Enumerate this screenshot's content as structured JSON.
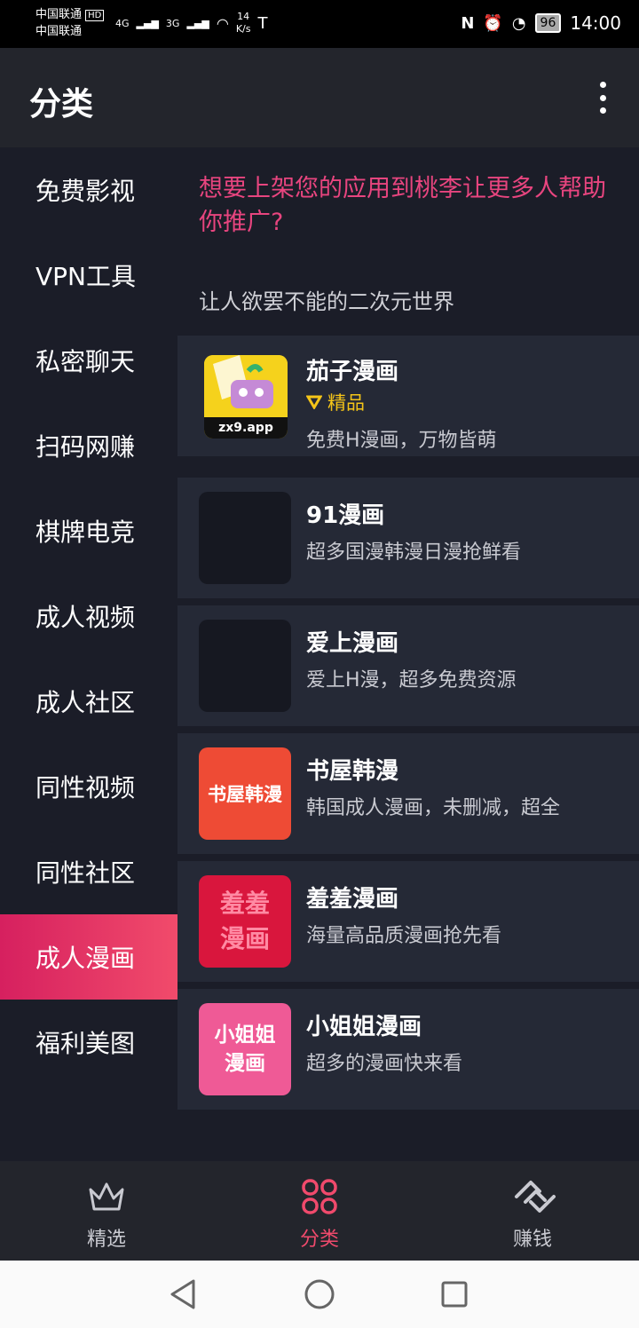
{
  "status_bar": {
    "carrier1": "中国联通",
    "carrier2": "中国联通",
    "hd": "HD",
    "net1": "4G",
    "net2": "3G",
    "speed_value": "14",
    "speed_unit": "K/s",
    "battery": "96",
    "time": "14:00"
  },
  "app_bar": {
    "title": "分类"
  },
  "sidebar": {
    "items": [
      {
        "label": "免费影视"
      },
      {
        "label": "VPN工具"
      },
      {
        "label": "私密聊天"
      },
      {
        "label": "扫码网赚"
      },
      {
        "label": "棋牌电竞"
      },
      {
        "label": "成人视频"
      },
      {
        "label": "成人社区"
      },
      {
        "label": "同性视频"
      },
      {
        "label": "同性社区"
      },
      {
        "label": "成人漫画"
      },
      {
        "label": "福利美图"
      }
    ],
    "active_index": 9
  },
  "content": {
    "promo_text": "想要上架您的应用到桃李让更多人帮助你推广?",
    "section_title": "让人欲罢不能的二次元世界",
    "apps": [
      {
        "name": "茄子漫画",
        "badge": "精品",
        "desc": "免费H漫画，万物皆萌",
        "icon_text": "zx9.app",
        "icon_color": "#f5d21c"
      },
      {
        "name": "91漫画",
        "desc": "超多国漫韩漫日漫抢鲜看"
      },
      {
        "name": "爱上漫画",
        "desc": "爱上H漫，超多免费资源"
      },
      {
        "name": "书屋韩漫",
        "desc": "韩国成人漫画，未删减，超全",
        "icon_text": "书屋韩漫",
        "icon_color": "#ee4b35"
      },
      {
        "name": "羞羞漫画",
        "desc": "海量高品质漫画抢先看",
        "icon_text_1": "羞羞",
        "icon_text_2": "漫画",
        "icon_color": "#d9163d"
      },
      {
        "name": "小姐姐漫画",
        "desc": "超多的漫画快来看",
        "icon_text_1": "小姐姐",
        "icon_text_2": "漫画",
        "icon_color": "#ef5a96"
      }
    ]
  },
  "bottom_nav": {
    "items": [
      {
        "label": "精选",
        "icon": "crown-icon"
      },
      {
        "label": "分类",
        "icon": "grid-icon"
      },
      {
        "label": "赚钱",
        "icon": "handshake-icon"
      }
    ],
    "active_index": 1,
    "accent_color": "#f04a6c"
  },
  "system_nav": [
    "back-icon",
    "home-icon",
    "recents-icon"
  ]
}
